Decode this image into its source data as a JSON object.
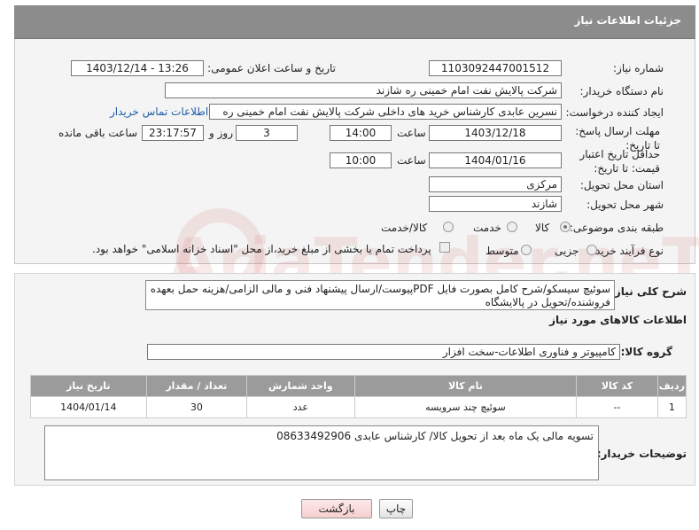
{
  "header": {
    "title": "جزئیات اطلاعات نیاز"
  },
  "form": {
    "need_number_label": "شماره نیاز:",
    "need_number": "1103092447001512",
    "announce_label": "تاریخ و ساعت اعلان عمومی:",
    "announce_value": "1403/12/14 - 13:26",
    "buyer_org_label": "نام دستگاه خریدار:",
    "buyer_org": "شرکت پالایش نفت امام خمینی  ره  شازند",
    "creator_label": "ایجاد کننده درخواست:",
    "creator": "نسرین عابدی کارشناس خرید های داخلی  شرکت پالایش نفت امام خمینی  ره",
    "contact_link": "اطلاعات تماس خریدار",
    "deadline_label": "مهلت ارسال پاسخ: تا تاریخ:",
    "deadline_date": "1403/12/18",
    "time_label": "ساعت",
    "deadline_time": "14:00",
    "days": "3",
    "days_label": "روز و",
    "remaining": "23:17:57",
    "remaining_label": "ساعت باقی مانده",
    "validity_label": "حداقل تاریخ اعتبار قیمت: تا تاریخ:",
    "validity_date": "1404/01/16",
    "validity_time": "10:00",
    "province_label": "استان محل تحویل:",
    "province": "مرکزی",
    "city_label": "شهر محل تحویل:",
    "city": "شازند",
    "category_label": "طبقه بندی موضوعی:",
    "category_options": [
      "کالا",
      "خدمت",
      "کالا/خدمت"
    ],
    "category_selected": "کالا",
    "process_label": "نوع فرآیند خرید :",
    "process_options": [
      "جزیی",
      "متوسط"
    ],
    "payment_note": "پرداخت تمام یا بخشی از مبلغ خرید،از محل \"اسناد خزانه اسلامی\" خواهد بود."
  },
  "description": {
    "label": "شرح کلی نیاز:",
    "text": "سوئیچ سیسکو/شرح کامل بصورت فایل PDFپیوست/ارسال پیشنهاد فنی و مالی الزامی/هزینه حمل بعهده فروشنده/تحویل در پالایشگاه"
  },
  "goods": {
    "section_title": "اطلاعات کالاهای مورد نیاز",
    "group_label": "گروه کالا:",
    "group_value": "کامپیوتر و فناوری اطلاعات-سخت افزار",
    "columns": [
      "ردیف",
      "کد کالا",
      "نام کالا",
      "واحد شمارش",
      "تعداد / مقدار",
      "تاریخ نیاز"
    ],
    "rows": [
      {
        "index": "1",
        "code": "--",
        "name": "سوئیچ چند سرویسه",
        "unit": "عدد",
        "qty": "30",
        "date": "1404/01/14"
      }
    ]
  },
  "buyer_notes": {
    "label": "توضیحات خریدار:",
    "text": "تسویه مالی یک ماه بعد از تحویل کالا/ کارشناس عابدی 08633492906"
  },
  "buttons": {
    "print": "چاپ",
    "back": "بازگشت"
  },
  "watermark": "AriaTender.neT"
}
